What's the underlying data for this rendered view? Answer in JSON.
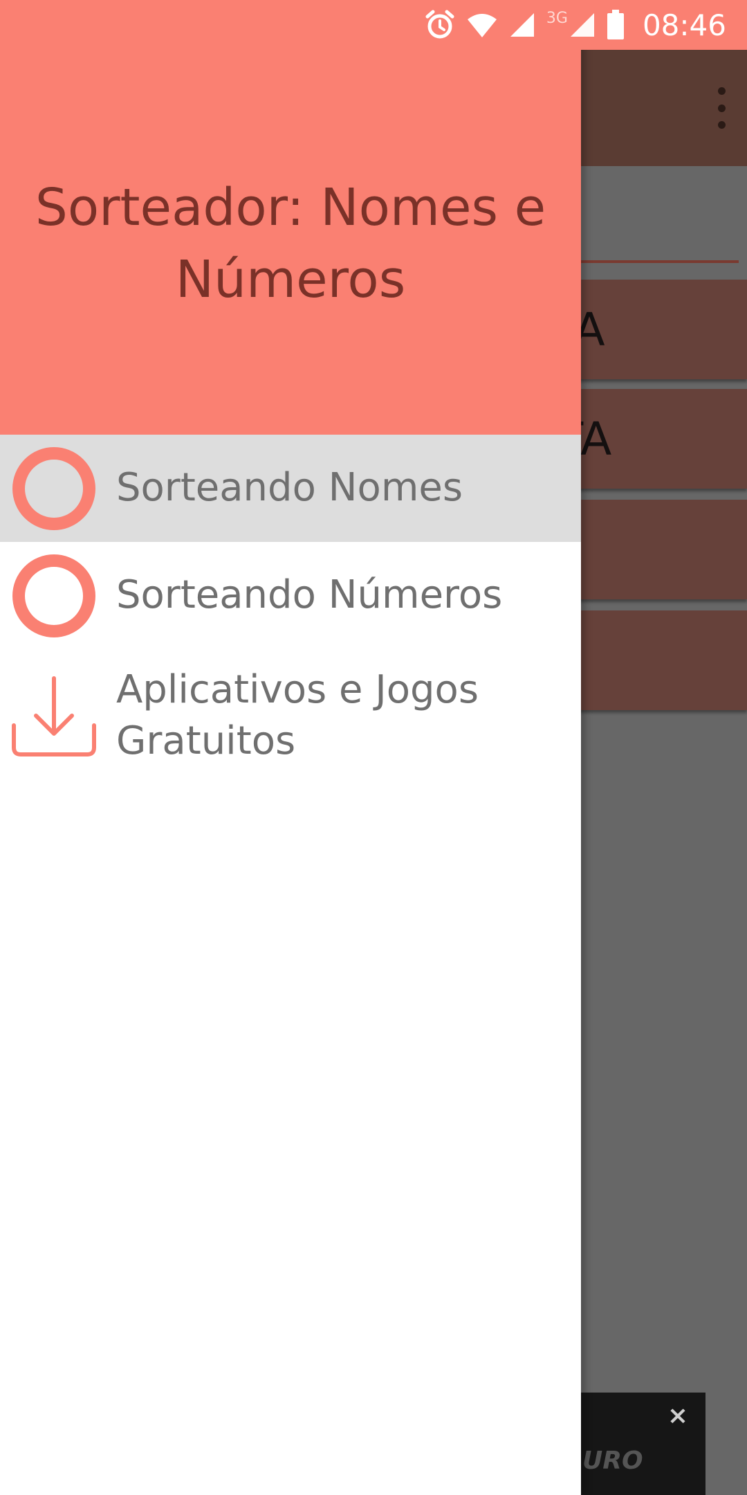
{
  "status_bar": {
    "time": "08:46",
    "network_label": "3G",
    "icons": [
      "alarm-icon",
      "wifi-icon",
      "signal-icon",
      "signal-3g-icon",
      "battery-icon"
    ]
  },
  "background_app": {
    "buttons": [
      {
        "label": "ISTA"
      },
      {
        "label": "STA"
      },
      {
        "label": ""
      },
      {
        "label": ""
      }
    ],
    "ad": {
      "text": "URO",
      "close_label": "×"
    }
  },
  "drawer": {
    "title": "Sorteador: Nomes e Números",
    "items": [
      {
        "label": "Sorteando Nomes",
        "icon": "ring-icon",
        "active": true
      },
      {
        "label": "Sorteando Números",
        "icon": "ring-icon",
        "active": false
      },
      {
        "label": "Aplicativos e Jogos Gratuitos",
        "icon": "download-icon",
        "active": false
      }
    ]
  },
  "colors": {
    "accent": "#fa8072",
    "toolbar": "#5a3c33",
    "button": "#66413a",
    "title_text": "#7a3128",
    "menu_text": "#6f6f6f",
    "active_row": "#dddddd"
  }
}
